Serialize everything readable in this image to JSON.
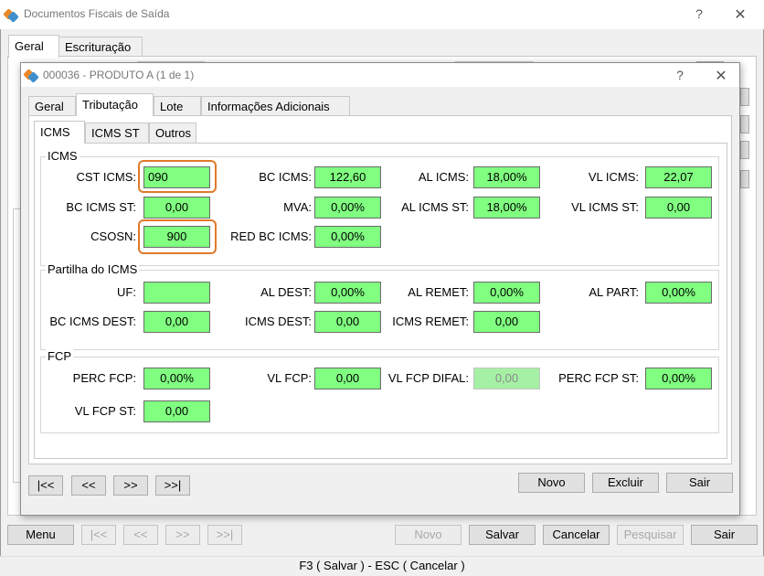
{
  "window": {
    "title": "Documentos Fiscais de Saída",
    "help_label": "?",
    "close_label": "✕",
    "tabs": [
      "Geral",
      "Escrituração"
    ]
  },
  "footer": {
    "buttons": {
      "menu": "Menu",
      "first": "|<<",
      "prev": "<<",
      "next": ">>",
      "last": ">>|",
      "novo": "Novo",
      "salvar": "Salvar",
      "cancelar": "Cancelar",
      "pesquisar": "Pesquisar",
      "sair": "Sair"
    },
    "status_text": "F3 ( Salvar )  -  ESC ( Cancelar )"
  },
  "modal": {
    "title": "000036 - PRODUTO A (1 de 1)",
    "help_label": "?",
    "close_label": "✕",
    "tabs": [
      "Geral",
      "Tributação",
      "Lote",
      "Informações Adicionais"
    ],
    "subtabs": [
      "ICMS",
      "ICMS ST",
      "Outros"
    ],
    "groups": {
      "icms": {
        "title": "ICMS",
        "cst_icms": {
          "label": "CST ICMS:",
          "value": "090"
        },
        "bc_icms": {
          "label": "BC ICMS:",
          "value": "122,60"
        },
        "al_icms": {
          "label": "AL ICMS:",
          "value": "18,00%"
        },
        "vl_icms": {
          "label": "VL ICMS:",
          "value": "22,07"
        },
        "bc_icms_st": {
          "label": "BC ICMS ST:",
          "value": "0,00"
        },
        "mva": {
          "label": "MVA:",
          "value": "0,00%"
        },
        "al_icms_st": {
          "label": "AL ICMS ST:",
          "value": "18,00%"
        },
        "vl_icms_st": {
          "label": "VL ICMS ST:",
          "value": "0,00"
        },
        "csosn": {
          "label": "CSOSN:",
          "value": "900"
        },
        "red_bc_icms": {
          "label": "RED BC ICMS:",
          "value": "0,00%"
        }
      },
      "partilha": {
        "title": "Partilha do ICMS",
        "uf": {
          "label": "UF:",
          "value": ""
        },
        "al_dest": {
          "label": "AL DEST:",
          "value": "0,00%"
        },
        "al_remet": {
          "label": "AL REMET:",
          "value": "0,00%"
        },
        "al_part": {
          "label": "AL PART:",
          "value": "0,00%"
        },
        "bc_icms_dest": {
          "label": "BC ICMS DEST:",
          "value": "0,00"
        },
        "icms_dest": {
          "label": "ICMS DEST:",
          "value": "0,00"
        },
        "icms_remet": {
          "label": "ICMS REMET:",
          "value": "0,00"
        }
      },
      "fcp": {
        "title": "FCP",
        "perc_fcp": {
          "label": "PERC FCP:",
          "value": "0,00%"
        },
        "vl_fcp": {
          "label": "VL FCP:",
          "value": "0,00"
        },
        "vl_fcp_difal": {
          "label": "VL FCP DIFAL:",
          "value": "0,00"
        },
        "perc_fcp_st": {
          "label": "PERC FCP ST:",
          "value": "0,00%"
        },
        "vl_fcp_st": {
          "label": "VL FCP ST:",
          "value": "0,00"
        }
      }
    },
    "buttons": {
      "first": "|<<",
      "prev": "<<",
      "next": ">>",
      "last": ">>|",
      "novo": "Novo",
      "excluir": "Excluir",
      "sair": "Sair"
    }
  },
  "colors": {
    "field_green": "#80ff80",
    "highlight_orange": "#e07a2a"
  }
}
